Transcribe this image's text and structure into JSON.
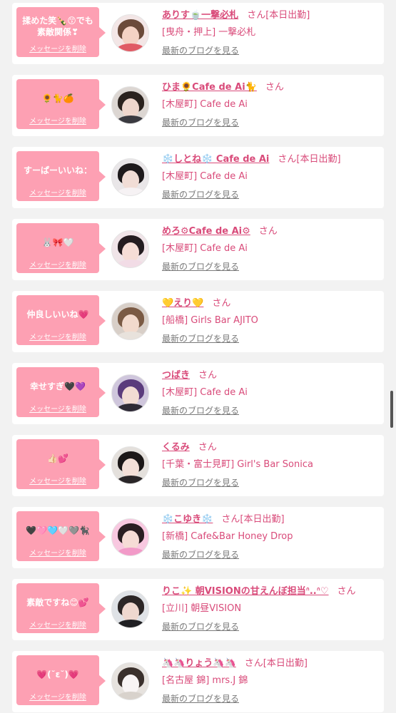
{
  "delete_label": "メッセージを削除",
  "blog_label": "最新のブログを見る",
  "san_label": "さん",
  "colors": {
    "accent": "#fda0b3",
    "name": "#d94b7a",
    "muted": "#7a7a7a"
  },
  "messages": [
    {
      "text": "揉めた笑🍾😙でも素敵関係❣",
      "name": "ありす🍵一撃必札",
      "status": "[本日出勤]",
      "shop": "[曳舟・押上] 一撃必札"
    },
    {
      "text": "🌻🐈🍊",
      "name": "ひま🌻Cafe de Ai🐈",
      "status": "",
      "shop": "[木屋町] Cafe de Ai"
    },
    {
      "text": "すーぱーいいね：",
      "name": "❄️しとね❄️ Cafe de Ai",
      "status": "[本日出勤]",
      "shop": "[木屋町] Cafe de Ai"
    },
    {
      "text": "🐰🎀🤍",
      "name": "めろ⚙Cafe de Ai⚙",
      "status": "",
      "shop": "[木屋町] Cafe de Ai"
    },
    {
      "text": "仲良しいいね💗",
      "name": "💛えり💛",
      "status": "",
      "shop": "[船橋] Girls Bar AJITO"
    },
    {
      "text": "幸せすぎ🖤💜",
      "name": "つばき",
      "status": "",
      "shop": "[木屋町] Cafe de Ai"
    },
    {
      "text": "👍🏻💕",
      "name": "くるみ",
      "status": "",
      "shop": "[千葉・富士見町] Girl's Bar Sonica"
    },
    {
      "text": "🖤🩷🩵🤍🩶🐈‍⬛",
      "name": "❄️こゆき❄️",
      "status": "[本日出勤]",
      "shop": "[新橋] Cafe&Bar Honey Drop"
    },
    {
      "text": "素敵ですね😊💕",
      "name": "りこ✨ 朝VISIONの甘えんぼ担当ᐢ..ᐢ♡",
      "status": "",
      "shop": "[立川] 朝昼VISION"
    },
    {
      "text": "💗(˘ε˘)💗",
      "name": "🦄🦄りょう🦄🦄",
      "status": "[本日出勤]",
      "shop": "[名古屋 錦] mrs.J 錦"
    }
  ]
}
